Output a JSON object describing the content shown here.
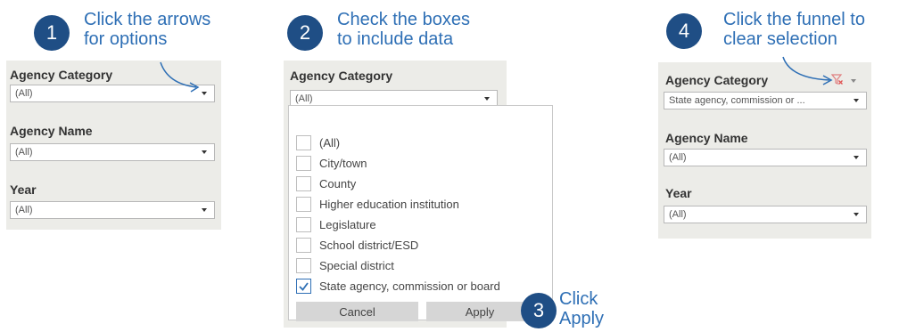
{
  "step1": {
    "number": "1",
    "text": "Click the arrows\nfor options"
  },
  "step2": {
    "number": "2",
    "text": "Check the boxes\nto include data"
  },
  "step3": {
    "number": "3",
    "text": "Click\nApply"
  },
  "step4": {
    "number": "4",
    "text": "Click the funnel to\nclear selection"
  },
  "panel1": {
    "filters": [
      {
        "label": "Agency Category",
        "value": "(All)"
      },
      {
        "label": "Agency Name",
        "value": "(All)"
      },
      {
        "label": "Year",
        "value": "(All)"
      }
    ]
  },
  "panel2": {
    "label": "Agency Category",
    "value": "(All)",
    "options": [
      {
        "label": "(All)",
        "checked": false
      },
      {
        "label": "City/town",
        "checked": false
      },
      {
        "label": "County",
        "checked": false
      },
      {
        "label": "Higher education institution",
        "checked": false
      },
      {
        "label": "Legislature",
        "checked": false
      },
      {
        "label": "School district/ESD",
        "checked": false
      },
      {
        "label": "Special district",
        "checked": false
      },
      {
        "label": "State agency, commission or board",
        "checked": true
      }
    ],
    "cancel_label": "Cancel",
    "apply_label": "Apply"
  },
  "panel4": {
    "filters": [
      {
        "label": "Agency Category",
        "value": "State agency, commission or ..."
      },
      {
        "label": "Agency Name",
        "value": "(All)"
      },
      {
        "label": "Year",
        "value": "(All)"
      }
    ]
  },
  "colors": {
    "badge": "#1f4e85",
    "instruction_text": "#2e6fb5",
    "panel_bg": "#ecece8",
    "funnel": "#e08080"
  }
}
